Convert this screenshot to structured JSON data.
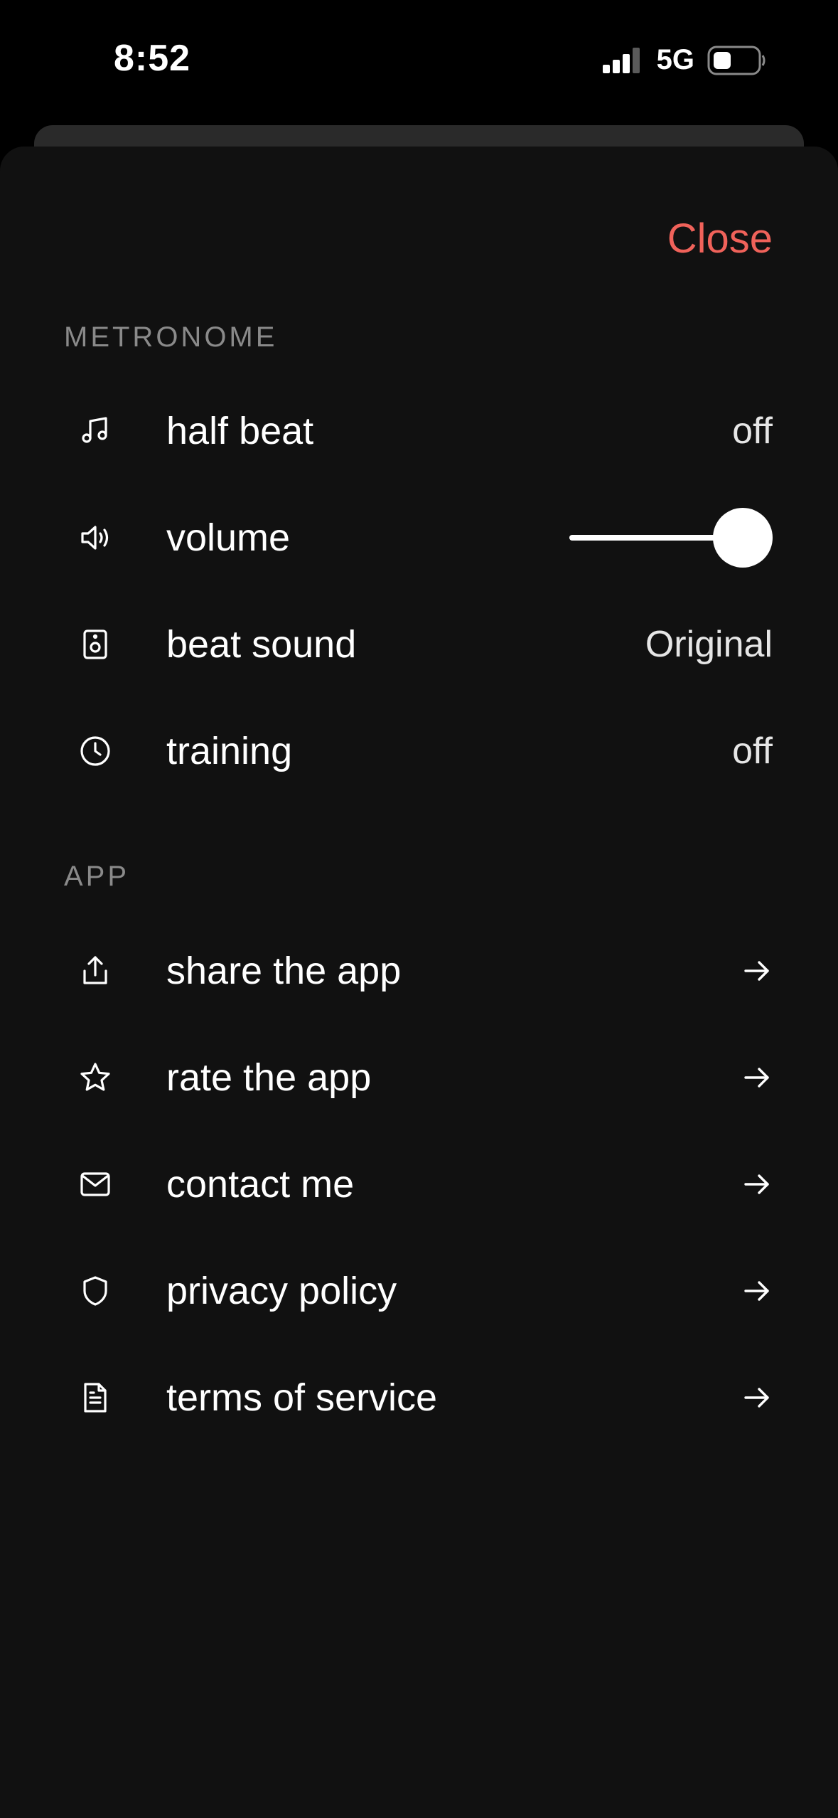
{
  "status_bar": {
    "time": "8:52",
    "network": "5G",
    "icons": [
      "signal-icon",
      "battery-icon"
    ]
  },
  "header": {
    "close_label": "Close",
    "accent_color": "#f0625a"
  },
  "metronome": {
    "section_title": "METRONOME",
    "items": [
      {
        "icon": "music-note-icon",
        "label": "half beat",
        "value": "off"
      },
      {
        "icon": "speaker-icon",
        "label": "volume",
        "level": 1.0
      },
      {
        "icon": "device-speaker-icon",
        "label": "beat sound",
        "value": "Original"
      },
      {
        "icon": "clock-icon",
        "label": "training",
        "value": "off"
      }
    ]
  },
  "app": {
    "section_title": "APP",
    "items": [
      {
        "icon": "share-icon",
        "label": "share the app",
        "action": "arrow-right-icon"
      },
      {
        "icon": "star-icon",
        "label": "rate the app",
        "action": "arrow-right-icon"
      },
      {
        "icon": "mail-icon",
        "label": "contact me",
        "action": "arrow-right-icon"
      },
      {
        "icon": "shield-icon",
        "label": "privacy policy",
        "action": "arrow-right-icon"
      },
      {
        "icon": "document-icon",
        "label": "terms of service",
        "action": "arrow-right-icon"
      }
    ]
  }
}
